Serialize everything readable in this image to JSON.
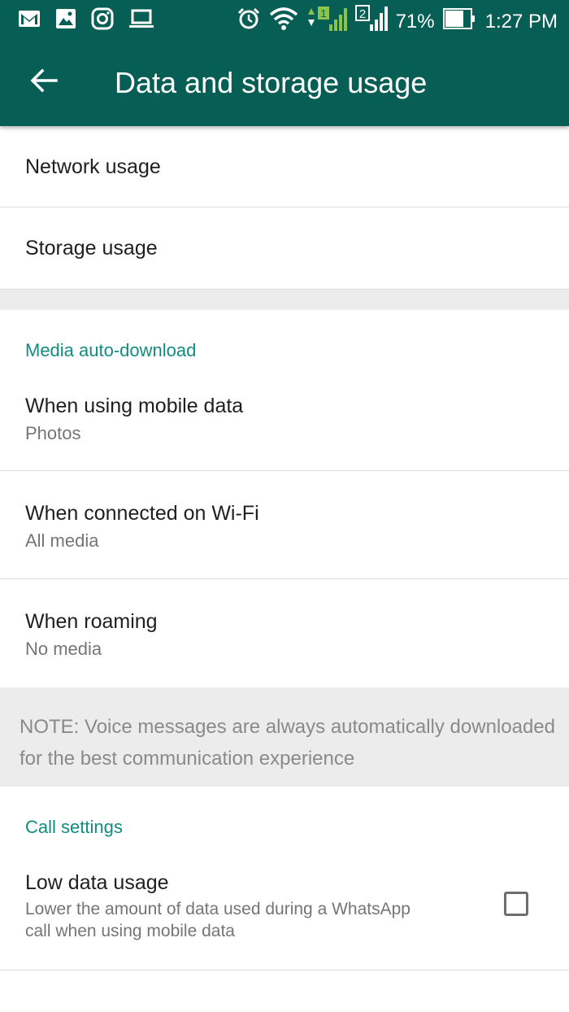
{
  "status_bar": {
    "battery_percent": "71%",
    "time": "1:27 PM",
    "sim1_label": "1",
    "sim2_label": "2",
    "icons": [
      "gmail-icon",
      "photos-icon",
      "instagram-icon",
      "laptop-icon",
      "alarm-icon",
      "wifi-icon",
      "signal-sim1-icon",
      "signal-sim2-icon",
      "battery-icon"
    ]
  },
  "app_bar": {
    "title": "Data and storage usage",
    "back_icon": "arrow-left-icon",
    "color": "#075e54"
  },
  "usage": {
    "network_label": "Network usage",
    "storage_label": "Storage usage"
  },
  "media_auto_download": {
    "header": "Media auto-download",
    "mobile": {
      "title": "When using mobile data",
      "value": "Photos"
    },
    "wifi": {
      "title": "When connected on Wi-Fi",
      "value": "All media"
    },
    "roaming": {
      "title": "When roaming",
      "value": "No media"
    },
    "note": "NOTE: Voice messages are always automatically downloaded for the best communication experience"
  },
  "call_settings": {
    "header": "Call settings",
    "low_data": {
      "title": "Low data usage",
      "description_line1": "Lower the amount of data used during a WhatsApp",
      "description_line2": "call when using mobile data",
      "checked": false
    }
  },
  "colors": {
    "accent": "#128c7e",
    "primary_dark": "#075e54",
    "secondary_text": "#757575",
    "band": "#ececec"
  }
}
